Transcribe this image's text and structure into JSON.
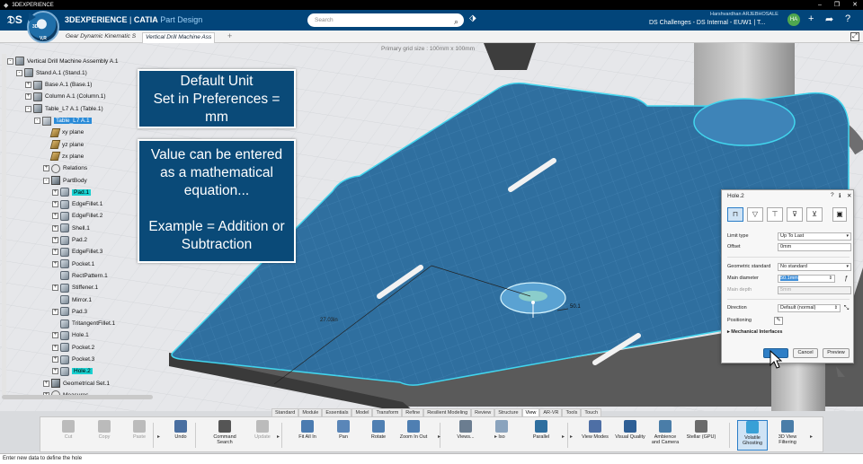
{
  "os": {
    "title": "3DEXPERIENCE",
    "win_min": "–",
    "win_max": "❐",
    "win_close": "✕"
  },
  "header": {
    "brand_prefix": "3DEXPERIENCE",
    "brand_sep": " | ",
    "brand_product": "CATIA",
    "brand_app": "Part Design",
    "search_placeholder": "Search",
    "user": "Harshvardhan ARJEBHOSALE",
    "collab_space": "DS Challenges - DS Internal - EUW1 | T...",
    "avatar_initials": "HA",
    "compass_3d": "3D",
    "compass_v": "V,R"
  },
  "tabs": [
    {
      "label": "Gear Dynamic Kinematic S"
    },
    {
      "label": "Vertical Drill Machine Ass"
    }
  ],
  "viewport": {
    "grid_label": "Primary grid size : 100mm x 100mm",
    "dim_label_1": "27.03in",
    "dim_label_2": "50.1"
  },
  "tree": [
    {
      "label": "Vertical Drill Machine Assembly A.1",
      "level": 0,
      "exp": "-",
      "icon": "prod"
    },
    {
      "label": "Stand A.1 (Stand.1)",
      "level": 1,
      "exp": "-",
      "icon": "prod"
    },
    {
      "label": "Base A.1 (Base.1)",
      "level": 2,
      "exp": "+",
      "icon": "prod"
    },
    {
      "label": "Column A.1 (Column.1)",
      "level": 2,
      "exp": "+",
      "icon": "prod"
    },
    {
      "label": "Table_L7 A.1 (Table.1)",
      "level": 2,
      "exp": "-",
      "icon": "prod"
    },
    {
      "label": "Table_L7 A.1",
      "level": 3,
      "exp": "-",
      "icon": "part",
      "state": "sel"
    },
    {
      "label": "xy plane",
      "level": 4,
      "exp": "",
      "icon": "plane"
    },
    {
      "label": "yz plane",
      "level": 4,
      "exp": "",
      "icon": "plane"
    },
    {
      "label": "zx plane",
      "level": 4,
      "exp": "",
      "icon": "plane"
    },
    {
      "label": "Relations",
      "level": 4,
      "exp": "+",
      "icon": "rel"
    },
    {
      "label": "PartBody",
      "level": 4,
      "exp": "-",
      "icon": "body"
    },
    {
      "label": "Pad.1",
      "level": 5,
      "exp": "+",
      "icon": "feat",
      "state": "hl"
    },
    {
      "label": "EdgeFillet.1",
      "level": 5,
      "exp": "+",
      "icon": "feat"
    },
    {
      "label": "EdgeFillet.2",
      "level": 5,
      "exp": "+",
      "icon": "feat"
    },
    {
      "label": "Shell.1",
      "level": 5,
      "exp": "+",
      "icon": "feat"
    },
    {
      "label": "Pad.2",
      "level": 5,
      "exp": "+",
      "icon": "feat"
    },
    {
      "label": "EdgeFillet.3",
      "level": 5,
      "exp": "+",
      "icon": "feat"
    },
    {
      "label": "Pocket.1",
      "level": 5,
      "exp": "+",
      "icon": "feat"
    },
    {
      "label": "RectPattern.1",
      "level": 5,
      "exp": "",
      "icon": "feat"
    },
    {
      "label": "Stiffener.1",
      "level": 5,
      "exp": "+",
      "icon": "feat"
    },
    {
      "label": "Mirror.1",
      "level": 5,
      "exp": "",
      "icon": "feat"
    },
    {
      "label": "Pad.3",
      "level": 5,
      "exp": "+",
      "icon": "feat"
    },
    {
      "label": "TritangentFillet.1",
      "level": 5,
      "exp": "",
      "icon": "feat"
    },
    {
      "label": "Hole.1",
      "level": 5,
      "exp": "+",
      "icon": "feat"
    },
    {
      "label": "Pocket.2",
      "level": 5,
      "exp": "+",
      "icon": "feat"
    },
    {
      "label": "Pocket.3",
      "level": 5,
      "exp": "+",
      "icon": "feat"
    },
    {
      "label": "Hole.2",
      "level": 5,
      "exp": "+",
      "icon": "feat",
      "state": "hl"
    },
    {
      "label": "Geometrical Set.1",
      "level": 4,
      "exp": "+",
      "icon": "body"
    },
    {
      "label": "Measures",
      "level": 4,
      "exp": "+",
      "icon": "rel"
    }
  ],
  "callouts": {
    "unit": [
      "Default Unit",
      "Set in Preferences =",
      "mm"
    ],
    "equation": [
      "Value can be entered",
      "as a mathematical",
      "equation...",
      "",
      "Example = Addition or",
      "Subtraction"
    ]
  },
  "dialog": {
    "title": "Hole.2",
    "help": "?",
    "info": "ℹ",
    "close": "✕",
    "hole_types": [
      "simple",
      "tapered",
      "counterbored",
      "countersunk",
      "counterdrilled"
    ],
    "limit_type_label": "Limit type",
    "limit_type_value": "Up To Last",
    "offset_label": "Offset",
    "offset_value": "0mm",
    "geo_std_label": "Geometric standard",
    "geo_std_value": "No standard",
    "main_diameter_label": "Main diameter",
    "main_diameter_value": "50.1mm",
    "main_depth_label": "Main depth",
    "main_depth_value": "5mm",
    "direction_label": "Direction",
    "direction_value": "Default (normal)",
    "positioning_label": "Positioning",
    "mech_label": "Mechanical Interfaces",
    "ok_label": "",
    "cancel_label": "Cancel",
    "preview_label": "Preview"
  },
  "action_tabs": [
    "Standard",
    "Module",
    "Essentials",
    "Model",
    "Transform",
    "Refine",
    "Resilient Modeling",
    "Review",
    "Structure",
    "View",
    "AR-VR",
    "Tools",
    "Touch"
  ],
  "action_active_tab": "View",
  "actions": [
    {
      "label": "Cut",
      "state": "off"
    },
    {
      "label": "Copy",
      "state": "off"
    },
    {
      "label": "Paste",
      "state": "off"
    },
    {
      "label": "Undo",
      "state": "on"
    },
    {
      "label": "Command Search",
      "state": "on"
    },
    {
      "label": "Update",
      "state": "off"
    },
    {
      "label": "Fit All In",
      "state": "on"
    },
    {
      "label": "Pan",
      "state": "on"
    },
    {
      "label": "Rotate",
      "state": "on"
    },
    {
      "label": "Zoom In Out",
      "state": "on"
    },
    {
      "label": "Views...",
      "state": "on"
    },
    {
      "label": "Iso",
      "state": "on"
    },
    {
      "label": "Parallel",
      "state": "on"
    },
    {
      "label": "View Modes",
      "state": "on"
    },
    {
      "label": "Visual Quality",
      "state": "on"
    },
    {
      "label": "Ambience and Camera",
      "state": "on"
    },
    {
      "label": "Stellar (GPU)",
      "state": "on"
    },
    {
      "label": "Volatile Ghosting",
      "state": "active"
    },
    {
      "label": "3D View Filtering",
      "state": "on"
    }
  ],
  "status": "Enter new data to define the hole",
  "colors": {
    "accent": "#02457a",
    "part": "#2f6f9f",
    "highlight": "#1ad0d0",
    "callout": "#0a4a78"
  }
}
